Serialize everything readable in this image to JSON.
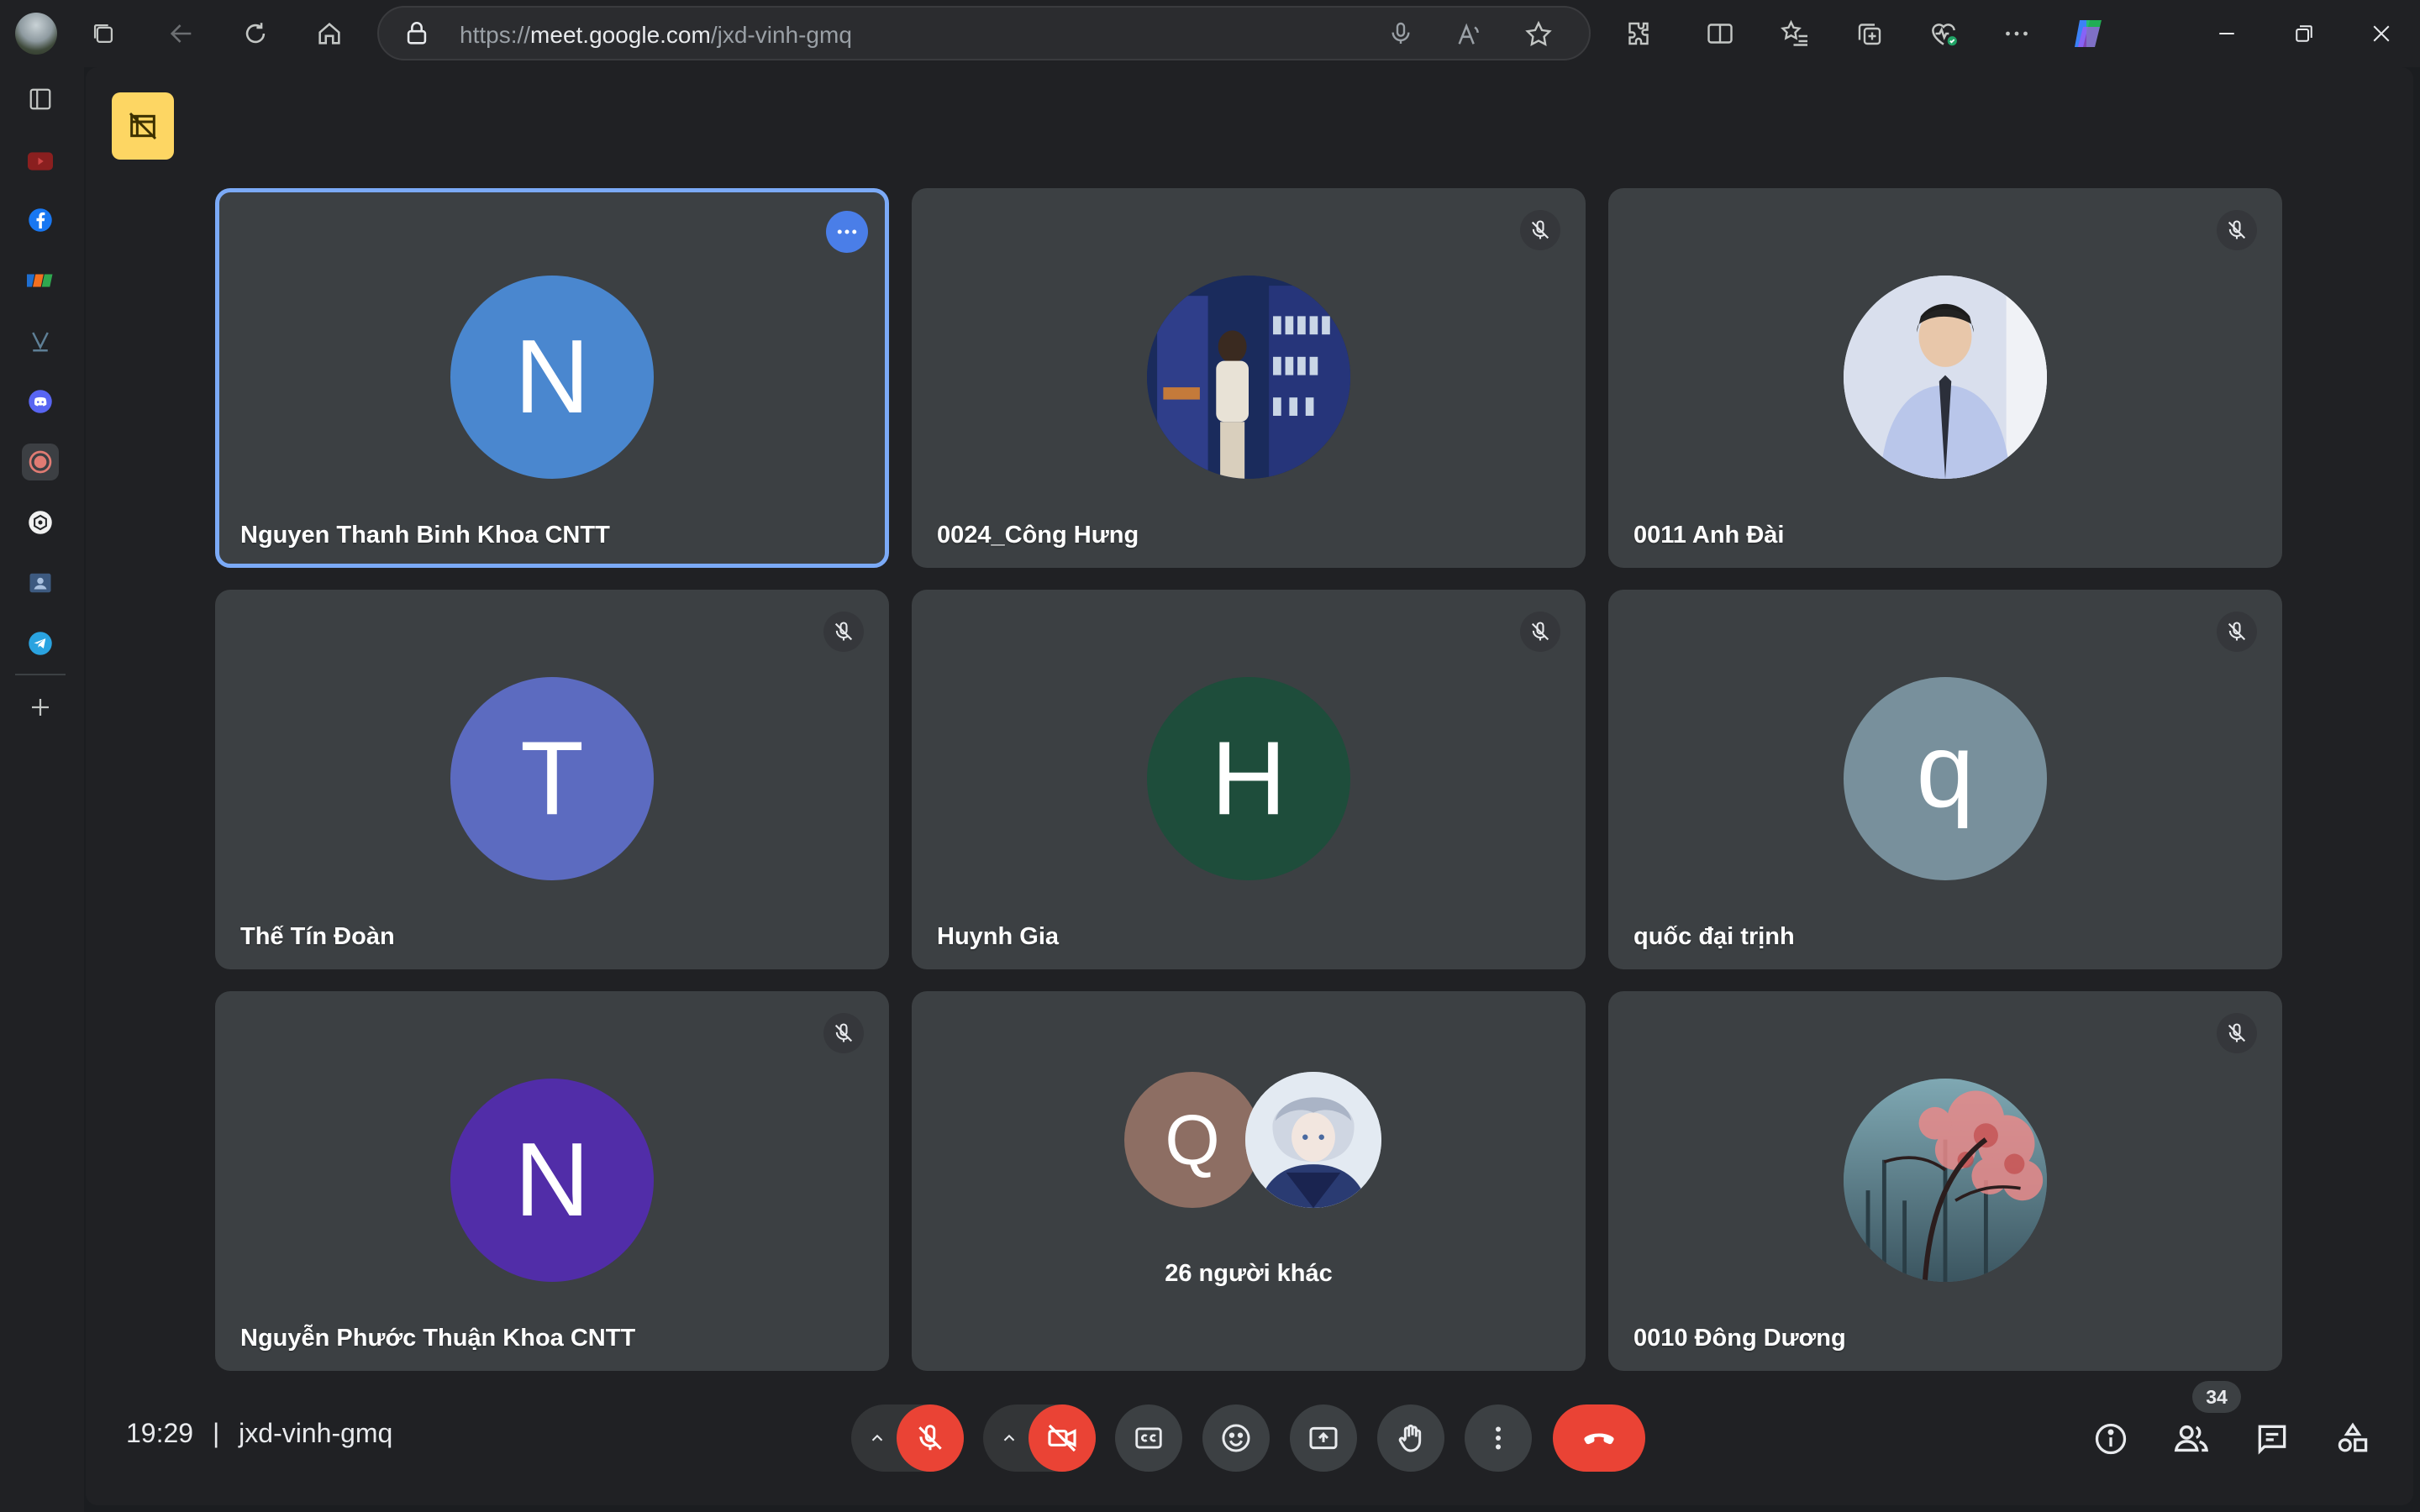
{
  "browser": {
    "url_prefix": "https://",
    "url_host": "meet.google.com",
    "url_path": "/jxd-vinh-gmq"
  },
  "sidebar": {
    "items": [
      "layout-icon",
      "youtube-icon",
      "facebook-icon",
      "fpt-icon",
      "v-logo-icon",
      "discord-icon",
      "record-icon",
      "chatgpt-icon",
      "contact-card-icon",
      "telegram-icon",
      "add-icon"
    ]
  },
  "tiles": [
    {
      "name": "Nguyen Thanh Binh Khoa CNTT",
      "initial": "N",
      "avatar_color": "#4a87cf",
      "active": true
    },
    {
      "name": "0024_Công Hưng",
      "initial": "",
      "avatar_color": "#2a3a6a",
      "muted": true
    },
    {
      "name": "0011 Anh Đài",
      "initial": "",
      "avatar_color": "#c8d2ea",
      "muted": true
    },
    {
      "name": "Thế Tín Đoàn",
      "initial": "T",
      "avatar_color": "#5c6bc0",
      "muted": true
    },
    {
      "name": "Huynh Gia",
      "initial": "H",
      "avatar_color": "#1e4d3b",
      "muted": true
    },
    {
      "name": "quốc đại trịnh",
      "initial": "q",
      "avatar_color": "#78909c",
      "muted": true
    },
    {
      "name": "Nguyễn Phước Thuận Khoa CNTT",
      "initial": "N",
      "avatar_color": "#512da8",
      "muted": true
    },
    {
      "name": "26 người khác",
      "initial": "Q",
      "avatar_color": "#8d6e63"
    },
    {
      "name": "0010 Đông Dương",
      "initial": "",
      "avatar_color": "#8a4a4a",
      "muted": true
    }
  ],
  "bottom": {
    "time": "19:29",
    "separator": "|",
    "meeting_code": "jxd-vinh-gmq",
    "participants_badge": "34"
  },
  "colors": {
    "end_call": "#ea4335",
    "accent": "#7baaf7",
    "notice_badge": "#fdd663"
  }
}
